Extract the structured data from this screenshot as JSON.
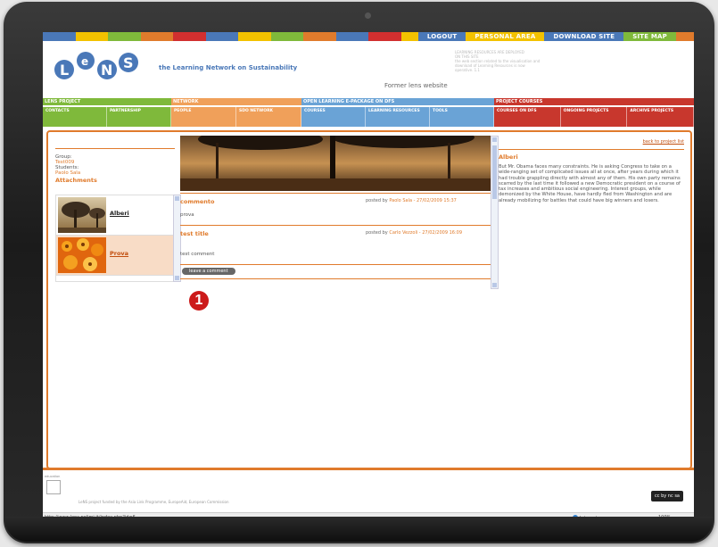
{
  "topnav": {
    "items": [
      {
        "label": "LOGOUT",
        "color": "#4a78b8"
      },
      {
        "label": "PERSONAL AREA",
        "color": "#f3c200"
      },
      {
        "label": "DOWNLOAD SITE",
        "color": "#4a78b8"
      },
      {
        "label": "SITE MAP",
        "color": "#7fb93b"
      }
    ],
    "stripe_colors": [
      "#4a78b8",
      "#f3c200",
      "#7fb93b",
      "#e07b2c",
      "#d12f2f",
      "#4a78b8",
      "#f3c200",
      "#7fb93b",
      "#e07b2c",
      "#4a78b8",
      "#d12f2f",
      "#f3c200",
      "#7fb93b",
      "#4a78b8",
      "#e07b2c",
      "#d12f2f",
      "#f3c200",
      "#4a78b8",
      "#7fb93b",
      "#e07b2c"
    ]
  },
  "header": {
    "logo_text": "LeNS",
    "tagline": "the Learning Network on Sustainability",
    "info_lines": [
      "LEARNING RESOURCES ARE DEPLOYED",
      "ON THIS SITE",
      "the web section related to the visualisation and",
      "download of Learning Resources is now",
      "operative. 1.1"
    ],
    "former_site": "Former lens website"
  },
  "menus": [
    {
      "title": "LENS PROJECT",
      "color": "#7fb93b",
      "items": [
        "CONTACTS",
        "PARTNERSHIP"
      ]
    },
    {
      "title": "NETWORK",
      "color": "#f0a05a",
      "items": [
        "PEOPLE",
        "SDO NETWORK"
      ]
    },
    {
      "title": "OPEN LEARNING E-PACKAGE ON DFS",
      "color": "#6aa3d6",
      "items": [
        "COURSES",
        "LEARNING RESOURCES",
        "TOOLS"
      ]
    },
    {
      "title": "PROJECT COURSES",
      "color": "#c8372d",
      "items": [
        "COURSES ON DFS",
        "ONGOING PROJECTS",
        "ARCHIVE PROJECTS"
      ]
    }
  ],
  "left": {
    "group_label": "Group:",
    "group_value": "Test009",
    "students_label": "Students:",
    "students_value": "Paolo Sala",
    "attachments_title": "Attachments",
    "attachments": [
      {
        "label": "Alberi",
        "selected": false
      },
      {
        "label": "Prova",
        "selected": true
      }
    ]
  },
  "comments": [
    {
      "title": "commento",
      "posted_prefix": "posted by",
      "author": "Paolo Sala - 27/02/2009 15:37",
      "text": "prova"
    },
    {
      "title": "test title",
      "posted_prefix": "posted by",
      "author": "Carlo Vezzoli - 27/02/2009 16:09",
      "text": "test comment"
    }
  ],
  "leave_comment_label": "leave a comment",
  "right": {
    "back_link": "back to project list",
    "title": "Alberi",
    "text": "But Mr. Obama faces many constraints. He is asking Congress to take on a wide-ranging set of complicated issues all at once, after years during which it had trouble grappling directly with almost any of them. His own party remains scarred by the last time it followed a new Democratic president on a course of tax increases and ambitious social engineering. Interest groups, while demonized by the White House, have hardly fled from Washington and are already mobilizing for battles that could have big winners and losers."
  },
  "annotation": "1",
  "footer": {
    "eu_label": "education",
    "text": "LeNS project funded by the Asia Link Programme, EuropeAid, European Commission",
    "cc_label": "cc by nc sa"
  },
  "statusbar": {
    "url": "http://www.lens.polimi.it/index.php?id=6",
    "zone": "Internet",
    "zoom": "100%"
  }
}
